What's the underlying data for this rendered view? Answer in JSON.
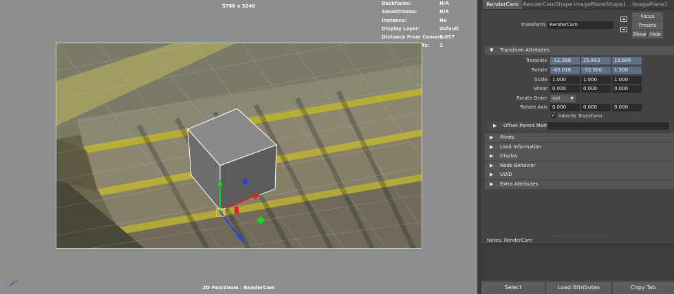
{
  "viewport": {
    "resolution_label": "5760 x 3240",
    "camera_label": "2D Pan/Zoom : RenderCam",
    "hud": [
      {
        "key": "Backfaces:",
        "value": "N/A"
      },
      {
        "key": "Smoothness:",
        "value": "N/A"
      },
      {
        "key": "Instance:",
        "value": "No"
      },
      {
        "key": "Display Layer:",
        "value": "default"
      },
      {
        "key": "Distance From Camera:",
        "value": "0.057"
      },
      {
        "key": "Selected Objects:",
        "value": "2"
      }
    ]
  },
  "attribute_editor": {
    "tabs": [
      "RenderCam",
      "RenderCamShape",
      "imagePlaneShape1",
      "imagePlane1"
    ],
    "active_tab": "RenderCam",
    "focus_label": "Focus",
    "presets_label": "Presets",
    "show_label": "Show",
    "hide_label": "Hide",
    "transform_label": "transform:",
    "transform_value": "RenderCam",
    "transform_section": "Transform Attributes",
    "rows": {
      "translate": {
        "label": "Translate",
        "values": [
          "-12.368",
          "25.643",
          "19.806"
        ]
      },
      "rotate": {
        "label": "Rotate",
        "values": [
          "-45.016",
          "-32.000",
          "1.500"
        ]
      },
      "scale": {
        "label": "Scale",
        "values": [
          "1.000",
          "1.000",
          "1.000"
        ]
      },
      "shear": {
        "label": "Shear",
        "values": [
          "0.000",
          "0.000",
          "0.000"
        ]
      },
      "rotate_order": {
        "label": "Rotate Order",
        "value": "xyz"
      },
      "rotate_axis": {
        "label": "Rotate Axis",
        "values": [
          "0.000",
          "0.000",
          "0.000"
        ]
      }
    },
    "inherits_transform_label": "Inherits Transform",
    "offset_parent_matrix_label": "Offset Parent Matrix",
    "sections": [
      "Pivots",
      "Limit Information",
      "Display",
      "Node Behavior",
      "UUID",
      "Extra Attributes"
    ],
    "notes_label": "Notes:",
    "notes_node": "RenderCam",
    "bottom_buttons": [
      "Select",
      "Load Attributes",
      "Copy Tab"
    ]
  }
}
